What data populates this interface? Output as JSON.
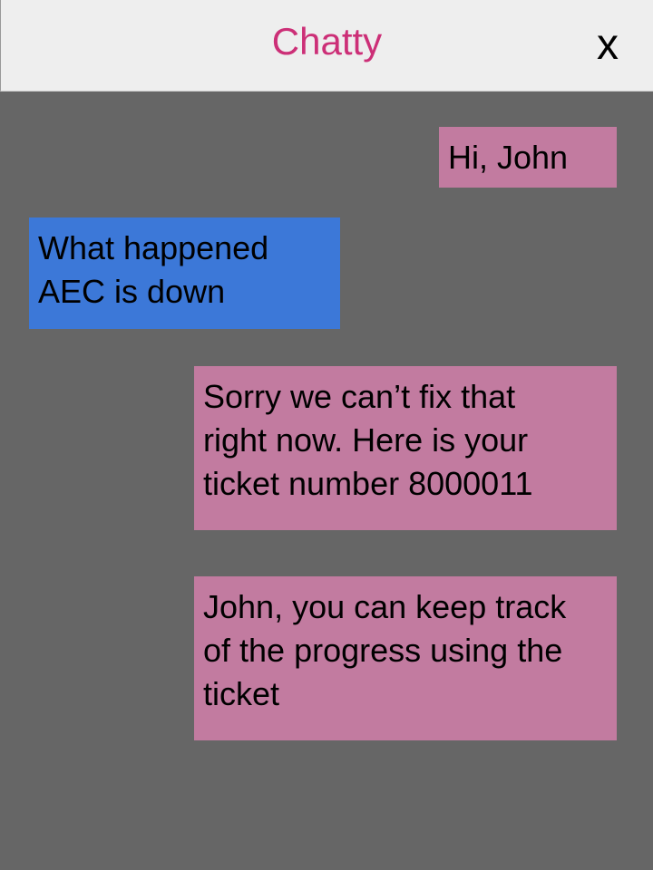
{
  "header": {
    "title": "Chatty",
    "close_label": "x"
  },
  "colors": {
    "background": "#666666",
    "header_bg": "#eeeeee",
    "title": "#cc2f77",
    "outgoing_bubble": "#c27ba0",
    "incoming_bubble": "#3c78d8"
  },
  "messages": [
    {
      "side": "right",
      "text": "Hi, John"
    },
    {
      "side": "left",
      "text": "What happened\nAEC is down"
    },
    {
      "side": "right",
      "text": "Sorry we can’t fix that\nright now. Here is your\nticket number 8000011"
    },
    {
      "side": "right",
      "text": "John, you can keep track\nof the progress using the\nticket"
    }
  ]
}
